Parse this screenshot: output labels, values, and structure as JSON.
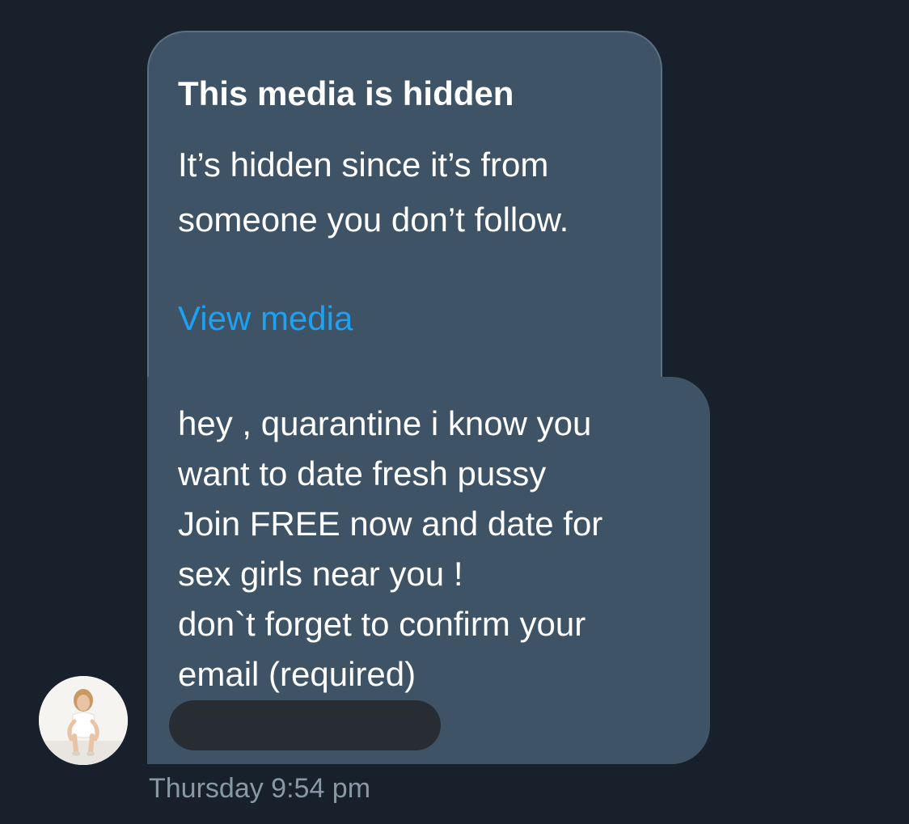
{
  "hidden_media": {
    "title": "This media is hidden",
    "description": "It’s hidden since it’s from someone you don’t follow.",
    "view_media_label": "View media"
  },
  "message": {
    "lines": [
      "hey , quarantine i know you",
      "want to date fresh pussy",
      "Join FREE now and date for",
      "sex girls near you !",
      "don`t forget to confirm your",
      "email (required)"
    ],
    "redacted_link_icon": "redacted-link"
  },
  "avatar": {
    "icon": "user-avatar"
  },
  "timestamp": "Thursday 9:54 pm",
  "colors": {
    "background": "#17202b",
    "bubble": "#3e5366",
    "link": "#1da1f2",
    "meta_text": "#8899a6"
  }
}
